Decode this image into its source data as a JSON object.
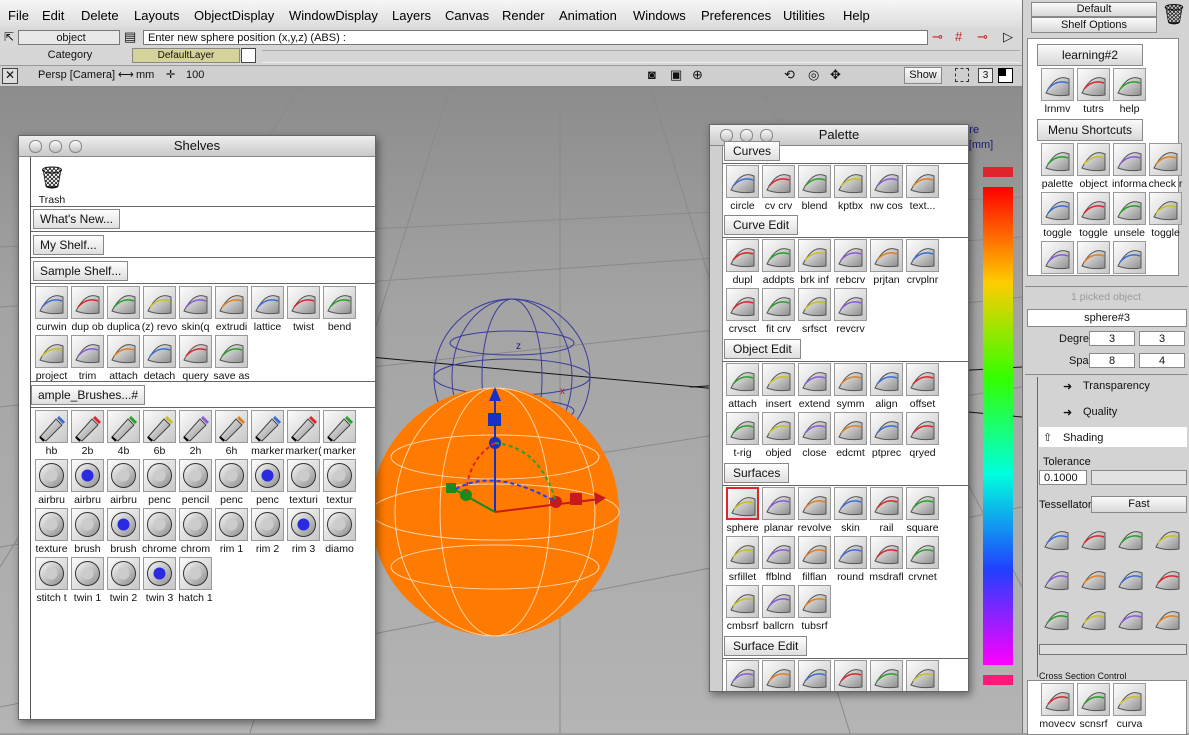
{
  "menubar": [
    "File",
    "Edit",
    "Delete",
    "Layouts",
    "ObjectDisplay",
    "WindowDisplay",
    "Layers",
    "Canvas",
    "Render",
    "Animation",
    "Windows",
    "Preferences",
    "Utilities",
    "Help"
  ],
  "prompt": {
    "pick_label": "object",
    "category_label": "Category",
    "text": "Enter new sphere position (x,y,z) (ABS) :"
  },
  "layer": {
    "name": "DefaultLayer"
  },
  "viewbar": {
    "camera": "Persp [Camera]",
    "units": "mm",
    "value": "100",
    "show": "Show",
    "pane_num": "3"
  },
  "shelves": {
    "title": "Shelves",
    "trash": "Trash",
    "whats_new": "What's New...",
    "my_shelf": "My Shelf...",
    "sample_shelf": "Sample Shelf...",
    "sample_tools": [
      "curwin",
      "dup ob",
      "duplica",
      "(z) revo",
      "skin(q",
      "extrudi",
      "lattice",
      "twist",
      "bend",
      "project",
      "trim",
      "attach",
      "detach",
      "query",
      "save as"
    ],
    "brushes_hdr": "ample_Brushes...#",
    "brushes": [
      "hb",
      "2b",
      "4b",
      "6b",
      "2h",
      "6h",
      "marker",
      "marker(",
      "marker",
      "airbru",
      "airbru",
      "airbru",
      "penc",
      "pencil",
      "penc",
      "penc",
      "texturi",
      "textur",
      "texture",
      "brush",
      "brush",
      "chrome",
      "chrom",
      "rim 1",
      "rim 2",
      "rim 3",
      "diamo",
      "stitch t",
      "twin 1",
      "twin 2",
      "twin 3",
      "hatch 1"
    ]
  },
  "palette": {
    "title": "Palette",
    "sections": [
      {
        "label": "Curves",
        "tools": [
          "circle",
          "cv crv",
          "blend",
          "kptbx",
          "nw cos",
          "text..."
        ]
      },
      {
        "label": "Curve Edit",
        "tools": [
          "dupl",
          "addpts",
          "brk inf",
          "rebcrv",
          "prjtan",
          "crvplnr",
          "crvsct",
          "fit crv",
          "srfsct",
          "revcrv"
        ]
      },
      {
        "label": "Object Edit",
        "tools": [
          "attach",
          "insert",
          "extend",
          "symm",
          "align",
          "offset",
          "t-rig",
          "objed",
          "close",
          "edcmt",
          "ptprec",
          "qryed"
        ]
      },
      {
        "label": "Surfaces",
        "tools": [
          "sphere",
          "planar",
          "revolve",
          "skin",
          "rail",
          "square",
          "srfillet",
          "ffblnd",
          "filflan",
          "round",
          "msdrafl",
          "crvnet",
          "cmbsrf",
          "ballcrn",
          "tubsrf"
        ]
      },
      {
        "label": "Surface Edit",
        "tools": [
          "",
          "",
          "",
          "",
          "",
          ""
        ]
      }
    ],
    "behind_text_1": "ature",
    "behind_text_2": "ues [mm]"
  },
  "right": {
    "default_btn": "Default",
    "shelf_options": "Shelf Options",
    "tab1": "learning#2",
    "tab1_tools": [
      "lrnmv",
      "tutrs",
      "help"
    ],
    "tab2": "Menu Shortcuts",
    "tab2_tools": [
      "palette",
      "object",
      "informa",
      "check r",
      "toggle",
      "toggle",
      "unsele",
      "toggle",
      "",
      "",
      ""
    ],
    "picked": "1 picked object",
    "obj_name": "sphere#3",
    "degree_label": "Degree",
    "degree": [
      "3",
      "3"
    ],
    "spans_label": "Spans",
    "spans": [
      "8",
      "4"
    ],
    "transparency": "Transparency",
    "quality": "Quality",
    "shading": "Shading",
    "tolerance_label": "Tolerance",
    "tolerance": "0.1000",
    "tessellator_label": "Tessellator",
    "tessellator": "Fast",
    "bottom_cut": "Cross Section Control",
    "bottom_tools": [
      "movecv",
      "scnsrf",
      "curva"
    ]
  },
  "colors": {
    "sphere": "#ff7a00",
    "accent_red": "#e0242b",
    "rainbow_top": "#ff0000"
  }
}
